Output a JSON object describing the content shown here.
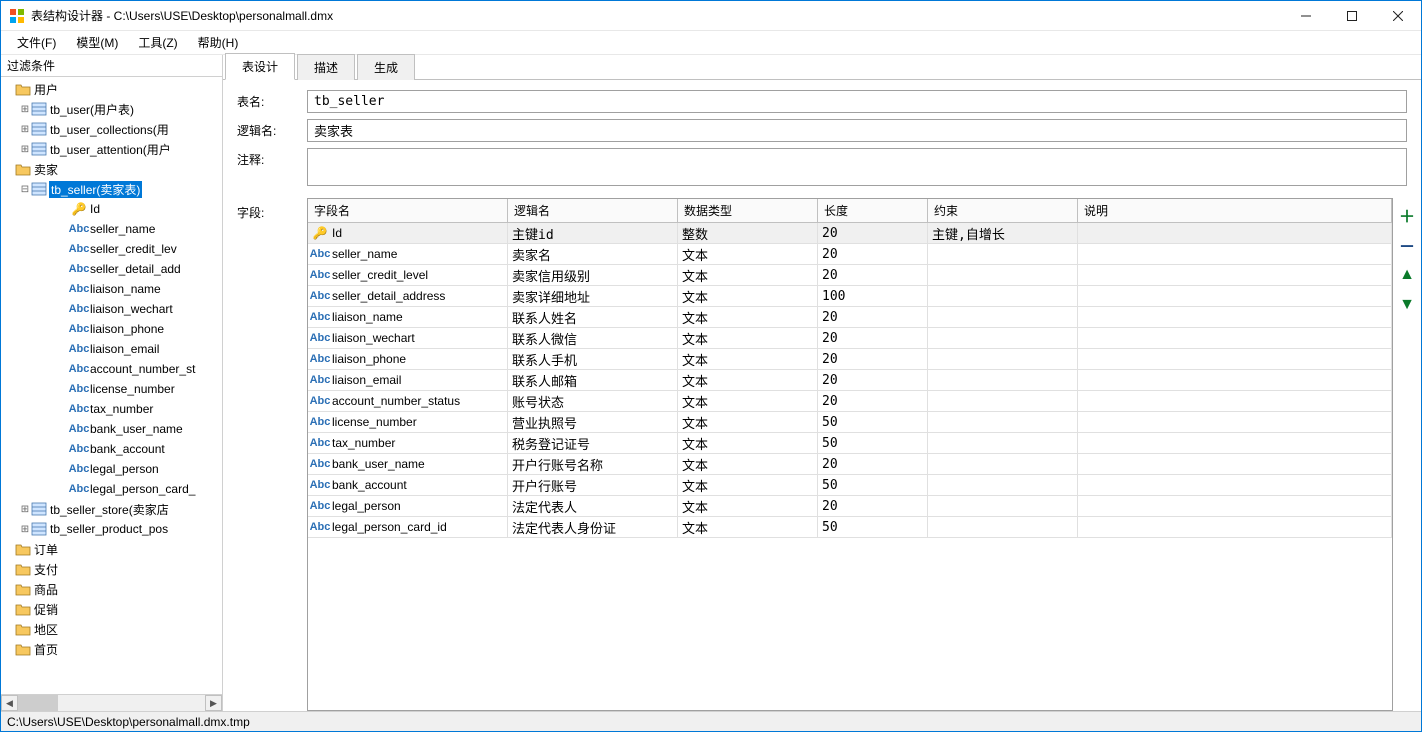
{
  "window": {
    "title": "表结构设计器 - C:\\Users\\USE\\Desktop\\personalmall.dmx"
  },
  "menu": {
    "file": "文件(F)",
    "model": "模型(M)",
    "tool": "工具(Z)",
    "help": "帮助(H)"
  },
  "filter_label": "过滤条件",
  "tree": {
    "users_folder": "用户",
    "tb_user": "tb_user(用户表)",
    "tb_user_collections": "tb_user_collections(用",
    "tb_user_attention": "tb_user_attention(用户",
    "sellers_folder": "卖家",
    "tb_seller": "tb_seller(卖家表)",
    "columns": {
      "id": "Id",
      "seller_name": "seller_name",
      "seller_credit_level": "seller_credit_lev",
      "seller_detail_address": "seller_detail_add",
      "liaison_name": "liaison_name",
      "liaison_wechart": "liaison_wechart",
      "liaison_phone": "liaison_phone",
      "liaison_email": "liaison_email",
      "account_number_status": "account_number_st",
      "license_number": "license_number",
      "tax_number": "tax_number",
      "bank_user_name": "bank_user_name",
      "bank_account": "bank_account",
      "legal_person": "legal_person",
      "legal_person_card_id": "legal_person_card_"
    },
    "tb_seller_store": "tb_seller_store(卖家店",
    "tb_seller_product_pos": "tb_seller_product_pos",
    "orders_folder": "订单",
    "pay_folder": "支付",
    "goods_folder": "商品",
    "promo_folder": "促销",
    "region_folder": "地区",
    "home_folder": "首页"
  },
  "tabs": {
    "design": "表设计",
    "desc": "描述",
    "gen": "生成"
  },
  "form": {
    "name_label": "表名:",
    "name_value": "tb_seller",
    "logic_label": "逻辑名:",
    "logic_value": "卖家表",
    "comment_label": "注释:",
    "comment_value": "",
    "fields_label": "字段:"
  },
  "grid": {
    "headers": {
      "name": "字段名",
      "logic": "逻辑名",
      "type": "数据类型",
      "len": "长度",
      "constraint": "约束",
      "desc": "说明"
    },
    "rows": [
      {
        "icon": "key",
        "name": "Id",
        "logic": "主键id",
        "type": "整数",
        "len": "20",
        "constraint": "主键,自增长",
        "desc": "",
        "sel": true
      },
      {
        "icon": "abc",
        "name": "seller_name",
        "logic": "卖家名",
        "type": "文本",
        "len": "20",
        "constraint": "",
        "desc": ""
      },
      {
        "icon": "abc",
        "name": "seller_credit_level",
        "logic": "卖家信用级别",
        "type": "文本",
        "len": "20",
        "constraint": "",
        "desc": ""
      },
      {
        "icon": "abc",
        "name": "seller_detail_address",
        "logic": "卖家详细地址",
        "type": "文本",
        "len": "100",
        "constraint": "",
        "desc": ""
      },
      {
        "icon": "abc",
        "name": "liaison_name",
        "logic": "联系人姓名",
        "type": "文本",
        "len": "20",
        "constraint": "",
        "desc": ""
      },
      {
        "icon": "abc",
        "name": "liaison_wechart",
        "logic": "联系人微信",
        "type": "文本",
        "len": "20",
        "constraint": "",
        "desc": ""
      },
      {
        "icon": "abc",
        "name": "liaison_phone",
        "logic": "联系人手机",
        "type": "文本",
        "len": "20",
        "constraint": "",
        "desc": ""
      },
      {
        "icon": "abc",
        "name": "liaison_email",
        "logic": "联系人邮箱",
        "type": "文本",
        "len": "20",
        "constraint": "",
        "desc": ""
      },
      {
        "icon": "abc",
        "name": "account_number_status",
        "logic": "账号状态",
        "type": "文本",
        "len": "20",
        "constraint": "",
        "desc": ""
      },
      {
        "icon": "abc",
        "name": "license_number",
        "logic": "营业执照号",
        "type": "文本",
        "len": "50",
        "constraint": "",
        "desc": ""
      },
      {
        "icon": "abc",
        "name": "tax_number",
        "logic": "税务登记证号",
        "type": "文本",
        "len": "50",
        "constraint": "",
        "desc": ""
      },
      {
        "icon": "abc",
        "name": "bank_user_name",
        "logic": "开户行账号名称",
        "type": "文本",
        "len": "20",
        "constraint": "",
        "desc": ""
      },
      {
        "icon": "abc",
        "name": "bank_account",
        "logic": "开户行账号",
        "type": "文本",
        "len": "50",
        "constraint": "",
        "desc": ""
      },
      {
        "icon": "abc",
        "name": "legal_person",
        "logic": "法定代表人",
        "type": "文本",
        "len": "20",
        "constraint": "",
        "desc": ""
      },
      {
        "icon": "abc",
        "name": "legal_person_card_id",
        "logic": "法定代表人身份证",
        "type": "文本",
        "len": "50",
        "constraint": "",
        "desc": ""
      }
    ]
  },
  "statusbar": "C:\\Users\\USE\\Desktop\\personalmall.dmx.tmp"
}
